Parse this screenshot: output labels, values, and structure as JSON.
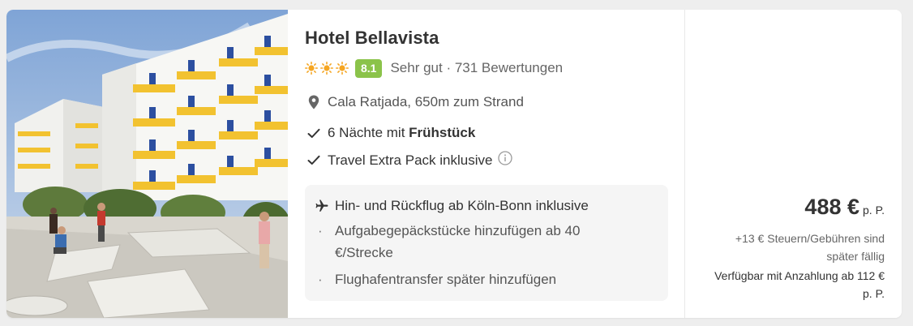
{
  "hotel": {
    "name": "Hotel Bellavista",
    "stars": 3,
    "score": "8.1",
    "rating_text": "Sehr gut · 731 Bewertungen",
    "location": "Cala Ratjada, 650m zum Strand",
    "meal_prefix": "6 Nächte mit ",
    "meal_bold": "Frühstück",
    "extra": "Travel Extra Pack inklusive"
  },
  "flight": {
    "headline": "Hin- und Rückflug ab Köln-Bonn inklusive",
    "bullets": [
      "Aufgabegepäckstücke hinzufügen ab 40 €/Strecke",
      "Flughafentransfer später hinzufügen"
    ]
  },
  "price": {
    "amount": "488 €",
    "unit": "p. P.",
    "taxes": "+13 € Steuern/Gebühren sind später fällig",
    "deposit": "Verfügbar mit Anzahlung ab 112 € p. P."
  },
  "colors": {
    "score_badge": "#8bc34a",
    "star": "#f5a623",
    "shutter": "#2c4fa0",
    "balcony": "#f2c230"
  },
  "icons": {
    "stars": "sun-star-icon",
    "location": "map-pin-icon",
    "check": "checkmark-icon",
    "info": "info-icon",
    "flight": "airplane-icon"
  }
}
